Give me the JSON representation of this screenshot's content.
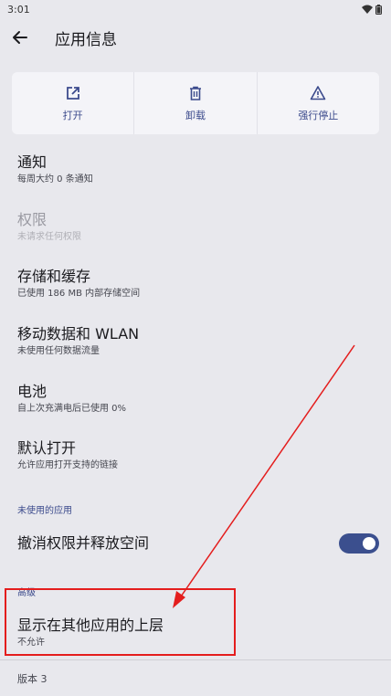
{
  "status_bar": {
    "time": "3:01",
    "wifi_icon": "wifi-icon",
    "battery_icon": "battery-icon"
  },
  "app_bar": {
    "back_icon": "arrow-back-icon",
    "title": "应用信息"
  },
  "actions": [
    {
      "label": "打开",
      "icon": "open-in-new-icon"
    },
    {
      "label": "卸载",
      "icon": "trash-icon"
    },
    {
      "label": "强行停止",
      "icon": "warning-icon"
    }
  ],
  "preferences": {
    "notifications": {
      "title": "通知",
      "summary": "每周大约 0 条通知"
    },
    "permissions": {
      "title": "权限",
      "summary": "未请求任何权限",
      "enabled": false
    },
    "storage": {
      "title": "存储和缓存",
      "summary": "已使用 186 MB 内部存储空间"
    },
    "data_usage": {
      "title": "移动数据和 WLAN",
      "summary": "未使用任何数据流量"
    },
    "battery": {
      "title": "电池",
      "summary": "自上次充满电后已使用 0%"
    },
    "open_by_default": {
      "title": "默认打开",
      "summary": "允许应用打开支持的链接"
    }
  },
  "unused_apps": {
    "category": "未使用的应用",
    "revoke_title": "撤消权限并释放空间",
    "toggle_on": true
  },
  "advanced": {
    "category": "高级",
    "overlay_title": "显示在其他应用的上层",
    "overlay_summary": "不允许"
  },
  "footer": {
    "version": "版本 3"
  },
  "colors": {
    "accent": "#3b4a8c",
    "toggle_track": "#3b4f8e",
    "annotation": "#e41d1d",
    "background": "#e8e8ed"
  }
}
